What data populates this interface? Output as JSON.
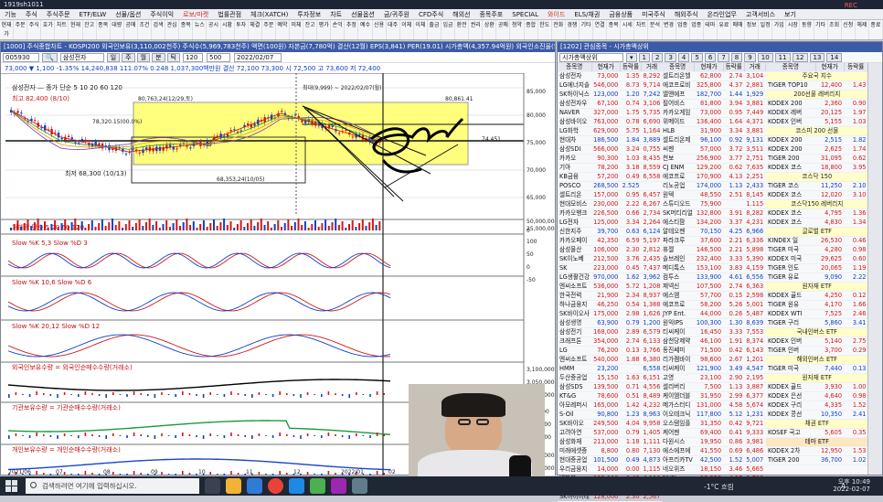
{
  "titlebar": {
    "title": "1919sh1011",
    "rec": "REC"
  },
  "menubar": [
    "기능",
    "주식",
    "주식주문",
    "ETF/ELW",
    "선물/옵션",
    "주식이익",
    "로보/마켓",
    "법률관점",
    "체크(XATCH)",
    "투자정보",
    "차트",
    "선물옵션",
    "금/귀주원",
    "CFD주식",
    "해외선",
    "종목주포",
    "SPECIAL",
    "와이드",
    "ELS/채권",
    "금융상품",
    "미국주식",
    "해외주식",
    "온라인업무",
    "고객서비스",
    "보기"
  ],
  "toolbar": [
    "현재가",
    "주문",
    "주식",
    "호가",
    "차트",
    "현재",
    "잔고",
    "종목",
    "대량",
    "공매",
    "조건",
    "검색",
    "관심",
    "종목",
    "뉴스",
    "공시",
    "시황",
    "투자",
    "체결",
    "주문",
    "예약",
    "미체",
    "잔고",
    "평가",
    "손익",
    "추정",
    "예수",
    "신용",
    "대주",
    "이체",
    "이체",
    "출금",
    "입금",
    "환전",
    "권리",
    "상환",
    "공매",
    "청약",
    "종합",
    "한도",
    "전화",
    "경쟁",
    "기타",
    "연결",
    "종목",
    "시세",
    "차트",
    "분석",
    "변경",
    "업종",
    "업종",
    "테마",
    "유료",
    "매매",
    "정보",
    "일정",
    "가입",
    "시장",
    "동향",
    "기타",
    "조회",
    "신청",
    "해제",
    "종료"
  ],
  "chart": {
    "panel_title": "[1000] 주식종합차트 - KOSPI200 외국인보유(3,110,002천주) 주식수(5,969,783천주) 액면(100원) 자본금(7,780억) 결산(12월) EPS(3,841) PER(19.01) 시가총액(4,357.94억원) 외국인소진율(52.3%)",
    "code": "005930",
    "name": "삼성전자",
    "period_tabs": [
      "일",
      "주",
      "월",
      "분",
      "틱"
    ],
    "date": "2022/02/07",
    "count": "120",
    "count2": "500",
    "info": "73,000  ▼ 1,100  -1.35%  14,240,838  111.07%  0.248  1,037,300백만원 결산  72,100  73,300  시  72,500  고  73,600  저  72,400",
    "ma_label": "삼성전자 — 종가 단순 5 10 20 60 120",
    "anno_high": "최고 82,400 (8/10)",
    "anno_low": "최저 68,300 (10/13)",
    "anno_box1": "80,763,24(12/29,토)",
    "anno_box2": "80,861.41",
    "anno_mid": "78,320.15(00.0%)",
    "anno_mid2": "68,353,24(10/05)",
    "anno_bot": "68,353,24(10/05,07,07)(2568,35)",
    "hover": "최대(9,999) ~ 2022/02/07(월)",
    "price_axis": [
      "85,000",
      "80,000",
      "75,000",
      "70,000",
      "65,000"
    ],
    "price_tag": "74,451",
    "vol_label": "거래량 단순 5 20 60 120",
    "vol_axis": [
      "50,000,000",
      "25,000,000",
      "0"
    ],
    "stoch1": "Slow %K 5,3  Slow %D 3",
    "stoch2": "Slow %K 10,6  Slow %D 6",
    "stoch3": "Slow %K 20,12  Slow %D 12",
    "foreign": "외국인보유수량 = 외국인순매수수량(거래소)",
    "institution": "기관보유수량 = 기관순매수수량(거래소)",
    "individual": "개인보유수량 = 개인순매수수량(거래소)",
    "osc_axis": [
      "100",
      "50",
      "0",
      "-50"
    ],
    "flow_axis1": [
      "3,100,000",
      "3,050,000",
      "3,000,000"
    ],
    "flow_axis2": [
      "225,000",
      "-225,000",
      "-400,000"
    ],
    "flow_axis3": [
      "4,860,000",
      "4,800,000"
    ],
    "x_axis": [
      "2021/06",
      "07",
      "08",
      "09",
      "10",
      "11",
      "12",
      "2022/01",
      "02"
    ]
  },
  "watch": {
    "panel_title": "[1202] 관심종목 - 시가총액상위",
    "group": "시가총액상위",
    "tab_labels": [
      "1",
      "2",
      "3",
      "4",
      "5",
      "6",
      "7",
      "8",
      "9",
      "10",
      "11",
      "12",
      "13",
      "14"
    ],
    "headers": [
      "종목명",
      "현재가",
      "등락률",
      "거래"
    ],
    "col1": [
      [
        "삼성전자",
        "73,000",
        "1.35",
        "8,292"
      ],
      [
        "LG에너지솔",
        "546,000",
        "8.73",
        "9,714"
      ],
      [
        "SK하이닉스",
        "123,000",
        "1.20",
        "7,242"
      ],
      [
        "삼성전자우",
        "67,100",
        "0.74",
        "3,106"
      ],
      [
        "NAVER",
        "327,000",
        "1.75",
        "5,735"
      ],
      [
        "삼성바이오",
        "763,000",
        "0.78",
        "6,690"
      ],
      [
        "LG화학",
        "629,000",
        "5.75",
        "1,164"
      ],
      [
        "현대차",
        "186,500",
        "1.84",
        "3,889"
      ],
      [
        "삼성SDI",
        "566,000",
        "3.24",
        "0,755"
      ],
      [
        "카카오",
        "90,300",
        "1.03",
        "8,435"
      ],
      [
        "기아",
        "78,200",
        "3.18",
        "8,559"
      ],
      [
        "KB금융",
        "57,200",
        "0.49",
        "6,558"
      ],
      [
        "POSCO",
        "268,500",
        "2.525",
        ""
      ],
      [
        "셀트리온",
        "157,000",
        "0.95",
        "6,457"
      ],
      [
        "현대모비스",
        "230,000",
        "2.22",
        "6,267"
      ],
      [
        "카카오뱅크",
        "226,500",
        "0.66",
        "2,734"
      ],
      [
        "LG전자",
        "125,000",
        "3.34",
        "2,264"
      ],
      [
        "신한지주",
        "39,700",
        "0.63",
        "6,124"
      ],
      [
        "카카오페이",
        "42,350",
        "6.59",
        "5,197"
      ],
      [
        "삼성물산",
        "106,000",
        "2.30",
        "2,812"
      ],
      [
        "SK이노베",
        "212,500",
        "3.76",
        "2,435"
      ],
      [
        "SK",
        "223,000",
        "0.45",
        "7,437"
      ],
      [
        "LG생활건강",
        "970,000",
        "1.62",
        "3,962"
      ],
      [
        "엔씨소프트",
        "536,000",
        "5.72",
        "1,208"
      ],
      [
        "한국전력",
        "21,900",
        "2.34",
        "8,937"
      ],
      [
        "하나금융지",
        "46,250",
        "0.54",
        "1,388"
      ],
      [
        "SK바이오사",
        "175,000",
        "2.98",
        "1,626"
      ],
      [
        "삼성생명",
        "63,900",
        "0.79",
        "1,200"
      ],
      [
        "삼성전기",
        "168,000",
        "2.89",
        "6,579"
      ],
      [
        "크래프톤",
        "354,000",
        "2.74",
        "6,133"
      ],
      [
        "LG",
        "76,200",
        "0.13",
        "3,766"
      ],
      [
        "엔씨소프트",
        "540,000",
        "1.88",
        "6,380"
      ],
      [
        "HMM",
        "23,200",
        "",
        "6,558"
      ],
      [
        "두산중공업",
        "15,150",
        "1.63",
        "6,151"
      ],
      [
        "삼성SDS",
        "139,500",
        "0.71",
        "4,556"
      ],
      [
        "KT&G",
        "78,600",
        "0.51",
        "8,489"
      ],
      [
        "아모레퍼시",
        "165,000",
        "1.42",
        "4,232"
      ],
      [
        "S-Oil",
        "90,800",
        "1.23",
        "8,963"
      ],
      [
        "SK바이오",
        "249,500",
        "4.04",
        "9,958"
      ],
      [
        "고려아연",
        "537,000",
        "0.79",
        "1,405"
      ],
      [
        "삼성화재",
        "213,000",
        "1.18",
        "1,111"
      ],
      [
        "미래에셋증",
        "8,800",
        "0.80",
        "7,130"
      ],
      [
        "현대중공업",
        "101,500",
        "0.49",
        "4,873"
      ],
      [
        "우리금융지",
        "14,000",
        "0.00",
        "1,115"
      ],
      [
        "넷마블",
        "103,000",
        "0.40",
        "4,106"
      ],
      [
        "포스코케미",
        "111,500",
        "2.19",
        "1,713"
      ],
      [
        "SK아이이테",
        "128,000",
        "2.30",
        "2,567"
      ]
    ],
    "col2": [
      [
        "셀트리온헬",
        "62,800",
        "2.74",
        "3,104"
      ],
      [
        "에코프로비",
        "325,800",
        "4.37",
        "2,881"
      ],
      [
        "엘앤에프",
        "182,700",
        "1.44",
        "1,929"
      ],
      [
        "펄어비스",
        "81,800",
        "3.94",
        "3,881"
      ],
      [
        "카카오게임",
        "73,000",
        "0.95",
        "7,449"
      ],
      [
        "위메이드",
        "136,400",
        "1.64",
        "4,371"
      ],
      [
        "HLB",
        "31,900",
        "3.34",
        "3,881"
      ],
      [
        "셀트리온제",
        "96,100",
        "0.92",
        "9,131"
      ],
      [
        "씨젠",
        "57,000",
        "3.72",
        "3,511"
      ],
      [
        "천보",
        "256,900",
        "3.77",
        "2,751"
      ],
      [
        "CJ ENM",
        "129,200",
        "0.62",
        "7,635"
      ],
      [
        "에코프로",
        "170,900",
        "4.13",
        "2,251"
      ],
      [
        "리노공업",
        "174,000",
        "1.13",
        "2,433"
      ],
      [
        "원텍",
        "48,550",
        "2.51",
        "8,145"
      ],
      [
        "스튜디오드",
        "75,900",
        "",
        "1.115"
      ],
      [
        "SK머티리얼",
        "132,800",
        "3.91",
        "8,282"
      ],
      [
        "에스티팜",
        "134,200",
        "3.37",
        "4,231"
      ],
      [
        "알테오젠",
        "70,150",
        "4.25",
        "6,966"
      ],
      [
        "파라크루",
        "37,600",
        "2.21",
        "6,336"
      ],
      [
        "휴젤",
        "146,500",
        "2.21",
        "5,898"
      ],
      [
        "솔브레인",
        "232,400",
        "3.33",
        "5,390"
      ],
      [
        "메디톡스",
        "153,100",
        "3.83",
        "4,159"
      ],
      [
        "컴투스",
        "133,900",
        "4.61",
        "6,556"
      ],
      [
        "제넥신",
        "107,500",
        "2.74",
        "6,363"
      ],
      [
        "에스엠",
        "57,700",
        "0.15",
        "2,598"
      ],
      [
        "에코프로",
        "58,200",
        "5.26",
        "5,001"
      ],
      [
        "JYP Ent.",
        "44,000",
        "0.26",
        "5,487"
      ],
      [
        "원익IPS",
        "100,300",
        "1.30",
        "8,639"
      ],
      [
        "티씨케이",
        "16,450",
        "3.33",
        "7,553"
      ],
      [
        "삼천당제약",
        "46,100",
        "1.91",
        "8,374"
      ],
      [
        "동진쎄미",
        "71,500",
        "0.42",
        "6,143"
      ],
      [
        "리가켐바이",
        "98,600",
        "2.67",
        "1,201"
      ],
      [
        "티씨케이",
        "121,900",
        "3.49",
        "4,547"
      ],
      [
        "고영",
        "23,100",
        "2.90",
        "2,195"
      ],
      [
        "셀리버리",
        "7,500",
        "1.13",
        "3,887"
      ],
      [
        "케이엠더블",
        "31,950",
        "2.99",
        "6,377"
      ],
      [
        "메가스터디",
        "131,000",
        "4.58",
        "5,674"
      ],
      [
        "이오테크닉",
        "117,800",
        "5.12",
        "1,231"
      ],
      [
        "오스템임플",
        "31,350",
        "0.42",
        "9,721"
      ],
      [
        "케어젠",
        "69,400",
        "0.41",
        "9,333"
      ],
      [
        "다원시스",
        "19,950",
        "0.86",
        "3,981"
      ],
      [
        "에스에프에",
        "41,550",
        "0.69",
        "6,486"
      ],
      [
        "아프리카TV",
        "42,500",
        "1.52",
        "5,007"
      ],
      [
        "네오위즈",
        "18,150",
        "3.46",
        "5,665"
      ],
      [
        "NHN",
        "18,550",
        "4.17",
        "9,700"
      ],
      [
        "티에스이",
        "55,100",
        "0.43",
        "9,867"
      ]
    ],
    "col3_header": [
      "종목명",
      "현재가",
      "등락률"
    ],
    "col3": [
      {
        "sec": "주요국 지수"
      },
      [
        "TIGER TOP10",
        "12,400",
        "1.43"
      ],
      {
        "sec": "200선물 레버리지"
      },
      [
        "KODEX 200",
        "2,360",
        "0.90"
      ],
      [
        "KODEX 레버",
        "20,125",
        "1.97"
      ],
      [
        "KODEX 인버",
        "5,155",
        "1.03"
      ],
      {
        "sec": "코스피 200 선물"
      },
      [
        "KODEX 200",
        "2,515",
        "1.82"
      ],
      [
        "KODEX 200",
        "2,625",
        "1.74"
      ],
      [
        "TIGER 200",
        "31,095",
        "0.62"
      ],
      [
        "KODEX 코스",
        "18,800",
        "3.95"
      ],
      {
        "sec": "코스닥 150"
      },
      [
        "TIGER 코스",
        "11,250",
        "2.10"
      ],
      [
        "KODEX 코스",
        "12,020",
        "3.10"
      ],
      {
        "sec": "코스닥150 레버리지"
      },
      [
        "KODEX 코스",
        "4,795",
        "1.36"
      ],
      [
        "KODEX 코스",
        "4,830",
        "1.34"
      ],
      {
        "sec": "글로벌 ETF"
      },
      [
        "KINDEX 일",
        "26,530",
        "0.46"
      ],
      [
        "TIGER 미국",
        "4,280",
        "0.98"
      ],
      [
        "KODEX 미국",
        "29,625",
        "0.60"
      ],
      [
        "TIGER 인도",
        "20,065",
        "1.19"
      ],
      [
        "TIGER 유로",
        "9,090",
        "2.22"
      ],
      {
        "sec": "원자재 ETF"
      },
      [
        "KODEX 골드",
        "4,250",
        "0.12"
      ],
      [
        "TIGER 원유",
        "4,170",
        "1.66"
      ],
      [
        "KODEX WTI",
        "7,525",
        "2.46"
      ],
      [
        "TIGER 구리",
        "5,860",
        "3.41"
      ],
      {
        "sec": "국내인버스 ETF"
      },
      [
        "KODEX 인버",
        "5,140",
        "2.75"
      ],
      [
        "TIGER 인버",
        "3,700",
        "0.29"
      ],
      {
        "sec": "해외인버스 ETF"
      },
      [
        "TIGER 미국",
        "7,440",
        "0.13"
      ],
      {
        "sec": "원자재 ETF"
      },
      [
        "KODEX 골드",
        "3,930",
        "1.00"
      ],
      [
        "KODEX 은선",
        "4,640",
        "0.98"
      ],
      [
        "KODEX 구리",
        "4,335",
        "1.52"
      ],
      [
        "KODEX 콩선",
        "10,350",
        "2.41"
      ],
      {
        "sec": "채권 ETF"
      },
      [
        "KOSEF 국고",
        "5,605",
        "0.35"
      ],
      {
        "sect": "테마 ETF"
      },
      [
        "KODEX 2차",
        "12,950",
        "1.53"
      ],
      [
        "TIGER 200",
        "36,700",
        "1.02"
      ]
    ]
  },
  "taskbar": {
    "search_placeholder": "검색하려면 여기에 입력하십시오.",
    "weather": "-1°C 흐림",
    "time": "오후 10:49",
    "date": "2022-02-07",
    "lang": "A"
  },
  "colors": {
    "title_blue": "#3b5aa8",
    "up": "#d01818",
    "down": "#1040c8",
    "highlight_box": "#ffff66"
  }
}
